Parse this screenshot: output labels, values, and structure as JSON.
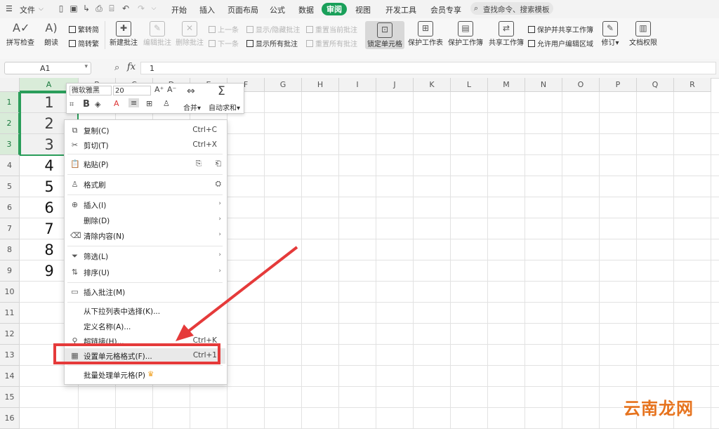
{
  "menubar": {
    "file_label": "文件",
    "tabs": [
      "开始",
      "插入",
      "页面布局",
      "公式",
      "数据",
      "审阅",
      "视图",
      "开发工具",
      "会员专享"
    ],
    "active_tab": "审阅",
    "search_placeholder": "查找命令、搜索模板"
  },
  "ribbon": {
    "spellcheck": "拼写检查",
    "read_aloud": "朗读",
    "trad_simp": "繁转简",
    "simp_trad": "简转繁",
    "new_comment": "新建批注",
    "edit_comment": "编辑批注",
    "delete_comment": "删除批注",
    "prev": "上一条",
    "next": "下一条",
    "show_hide_comment": "显示/隐藏批注",
    "show_all_comments": "显示所有批注",
    "reset_current_comment": "重置当前批注",
    "reset_all_comments": "重置所有批注",
    "lock_cell": "锁定单元格",
    "protect_sheet": "保护工作表",
    "protect_book": "保护工作簿",
    "share_book": "共享工作簿",
    "protect_share_book": "保护并共享工作簿",
    "allow_edit_ranges": "允许用户编辑区域",
    "revise": "修订",
    "doc_rights": "文档权限"
  },
  "formula_bar": {
    "name_box": "A1",
    "fx_label": "fx",
    "value": "1"
  },
  "grid": {
    "columns": [
      "A",
      "B",
      "C",
      "D",
      "E",
      "F",
      "G",
      "H",
      "I",
      "J",
      "K",
      "L",
      "M",
      "N",
      "O",
      "P",
      "Q",
      "R"
    ],
    "rows": [
      "1",
      "2",
      "3",
      "4",
      "5",
      "6",
      "7",
      "8",
      "9",
      "10",
      "11",
      "12",
      "13",
      "14",
      "15",
      "16"
    ],
    "col_a_values": [
      "1",
      "2",
      "3",
      "4",
      "5",
      "6",
      "7",
      "8",
      "9"
    ]
  },
  "mini_toolbar": {
    "font_name": "微软雅黑",
    "font_size": "20",
    "merge": "合并",
    "autosum": "自动求和"
  },
  "context_menu": {
    "copy": "复制(C)",
    "copy_sc": "Ctrl+C",
    "cut": "剪切(T)",
    "cut_sc": "Ctrl+X",
    "paste": "粘贴(P)",
    "format_painter": "格式刷",
    "insert": "插入(I)",
    "delete": "删除(D)",
    "clear": "清除内容(N)",
    "filter": "筛选(L)",
    "sort": "排序(U)",
    "insert_comment": "插入批注(M)",
    "pick_from_list": "从下拉列表中选择(K)...",
    "define_name": "定义名称(A)...",
    "hyperlink": "超链接(H)...",
    "hyperlink_sc": "Ctrl+K",
    "format_cells": "设置单元格格式(F)...",
    "format_cells_sc": "Ctrl+1",
    "batch_cells": "批量处理单元格(P)"
  },
  "watermark": "云南龙网",
  "colors": {
    "accent_green": "#1aa05a",
    "highlight_red": "#e53a3a",
    "watermark": "#e6731e"
  }
}
